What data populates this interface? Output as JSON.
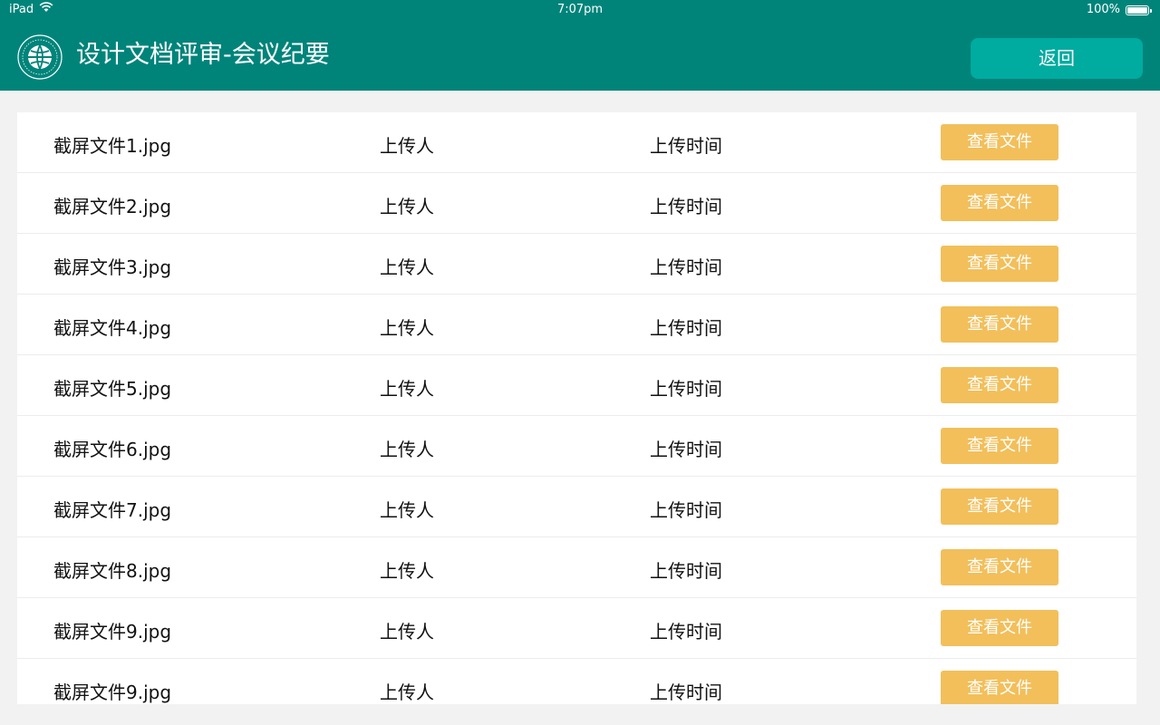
{
  "status_bar": {
    "device": "iPad",
    "time": "7:07pm",
    "battery": "100%",
    "battery_level": 1.0
  },
  "header": {
    "title": "设计文档评审-会议纪要",
    "back_label": "返回",
    "logo_icon": "state-grid-logo-icon"
  },
  "colors": {
    "header_bg": "#00847a",
    "back_button_bg": "#00aba0",
    "view_button_bg": "#f2bf5b",
    "page_bg": "#f2f2f2"
  },
  "files": [
    {
      "name": "截屏文件1.jpg",
      "uploader": "上传人",
      "time": "上传时间",
      "action": "查看文件"
    },
    {
      "name": "截屏文件2.jpg",
      "uploader": "上传人",
      "time": "上传时间",
      "action": "查看文件"
    },
    {
      "name": "截屏文件3.jpg",
      "uploader": "上传人",
      "time": "上传时间",
      "action": "查看文件"
    },
    {
      "name": "截屏文件4.jpg",
      "uploader": "上传人",
      "time": "上传时间",
      "action": "查看文件"
    },
    {
      "name": "截屏文件5.jpg",
      "uploader": "上传人",
      "time": "上传时间",
      "action": "查看文件"
    },
    {
      "name": "截屏文件6.jpg",
      "uploader": "上传人",
      "time": "上传时间",
      "action": "查看文件"
    },
    {
      "name": "截屏文件7.jpg",
      "uploader": "上传人",
      "time": "上传时间",
      "action": "查看文件"
    },
    {
      "name": "截屏文件8.jpg",
      "uploader": "上传人",
      "time": "上传时间",
      "action": "查看文件"
    },
    {
      "name": "截屏文件9.jpg",
      "uploader": "上传人",
      "time": "上传时间",
      "action": "查看文件"
    },
    {
      "name": "截屏文件9.jpg",
      "uploader": "上传人",
      "time": "上传时间",
      "action": "查看文件"
    }
  ]
}
